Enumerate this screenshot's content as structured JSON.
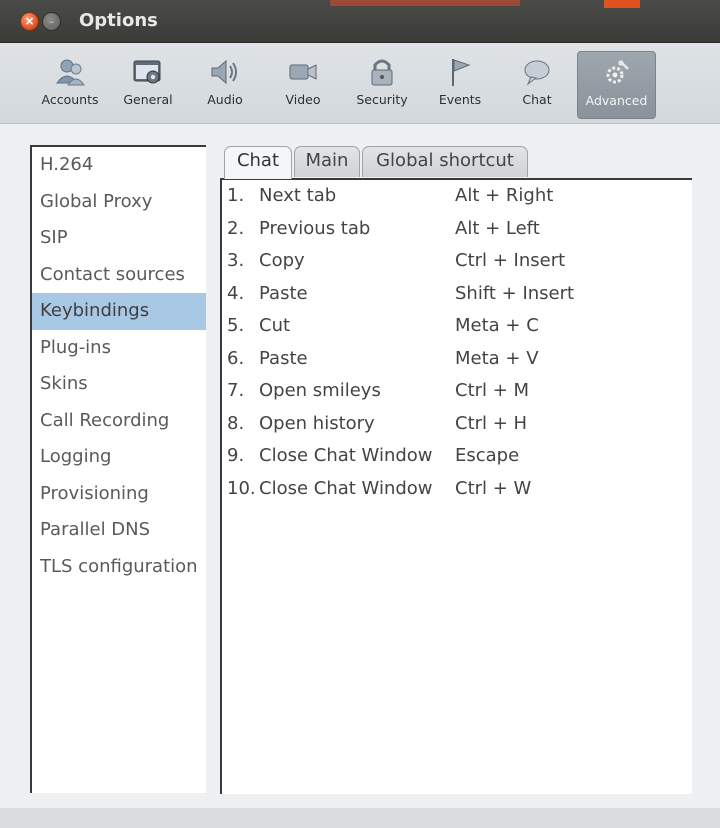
{
  "window": {
    "title": "Options"
  },
  "toolbar": {
    "buttons": [
      {
        "label": "Accounts",
        "icon": "accounts-icon"
      },
      {
        "label": "General",
        "icon": "general-icon"
      },
      {
        "label": "Audio",
        "icon": "audio-icon"
      },
      {
        "label": "Video",
        "icon": "video-icon"
      },
      {
        "label": "Security",
        "icon": "security-icon"
      },
      {
        "label": "Events",
        "icon": "events-icon"
      },
      {
        "label": "Chat",
        "icon": "chat-icon"
      },
      {
        "label": "Advanced",
        "icon": "advanced-icon"
      }
    ],
    "active": "Advanced"
  },
  "sidebar": {
    "items": [
      "H.264",
      "Global Proxy",
      "SIP",
      "Contact sources",
      "Keybindings",
      "Plug-ins",
      "Skins",
      "Call Recording",
      "Logging",
      "Provisioning",
      "Parallel DNS",
      "TLS configuration"
    ],
    "selected": "Keybindings",
    "selected_color": "#a9c8e6"
  },
  "tabs": {
    "items": [
      "Chat",
      "Main",
      "Global shortcut"
    ],
    "active": "Chat"
  },
  "keybindings": [
    {
      "num": "1.",
      "action": "Next tab",
      "keys": "Alt + Right"
    },
    {
      "num": "2.",
      "action": "Previous tab",
      "keys": "Alt + Left"
    },
    {
      "num": "3.",
      "action": "Copy",
      "keys": "Ctrl + Insert"
    },
    {
      "num": "4.",
      "action": "Paste",
      "keys": "Shift + Insert"
    },
    {
      "num": "5.",
      "action": "Cut",
      "keys": "Meta + C"
    },
    {
      "num": "6.",
      "action": "Paste",
      "keys": "Meta + V"
    },
    {
      "num": "7.",
      "action": "Open smileys",
      "keys": "Ctrl + M"
    },
    {
      "num": "8.",
      "action": "Open history",
      "keys": "Ctrl + H"
    },
    {
      "num": "9.",
      "action": "Close Chat Window",
      "keys": "Escape"
    },
    {
      "num": "10.",
      "action": "Close Chat Window",
      "keys": "Ctrl + W"
    }
  ]
}
